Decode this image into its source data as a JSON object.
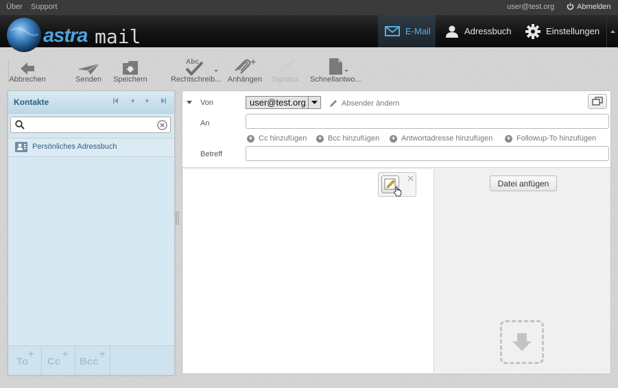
{
  "topbar": {
    "about": "Über",
    "support": "Support",
    "user": "user@test.org",
    "logout": "Abmelden"
  },
  "brand": {
    "logo_text_1": "astra",
    "logo_text_2": "mail"
  },
  "nav": {
    "email": "E-Mail",
    "addressbook": "Adressbuch",
    "settings": "Einstellungen",
    "active_color": "#5aaee0"
  },
  "toolbar": {
    "cancel": "Abbrechen",
    "send": "Senden",
    "save": "Speichern",
    "spellcheck": "Rechtschreib...",
    "attach": "Anhängen",
    "signature": "Signatur",
    "quickreply": "Schnellantwo..."
  },
  "contacts": {
    "title": "Kontakte",
    "search_value": "",
    "addressbook": "Persönliches Adressbuch",
    "to": "To",
    "cc": "Cc",
    "bcc": "Bcc"
  },
  "compose": {
    "from_label": "Von",
    "from_value": "user@test.org",
    "change_sender": "Absender ändern",
    "to_label": "An",
    "to_value": "",
    "add_cc": "Cc hinzufügen",
    "add_bcc": "Bcc hinzufügen",
    "add_replyto": "Antwortadresse hinzufügen",
    "add_followup": "Followup-To hinzufügen",
    "subject_label": "Betreff",
    "subject_value": "",
    "attach_file": "Datei anfügen"
  }
}
